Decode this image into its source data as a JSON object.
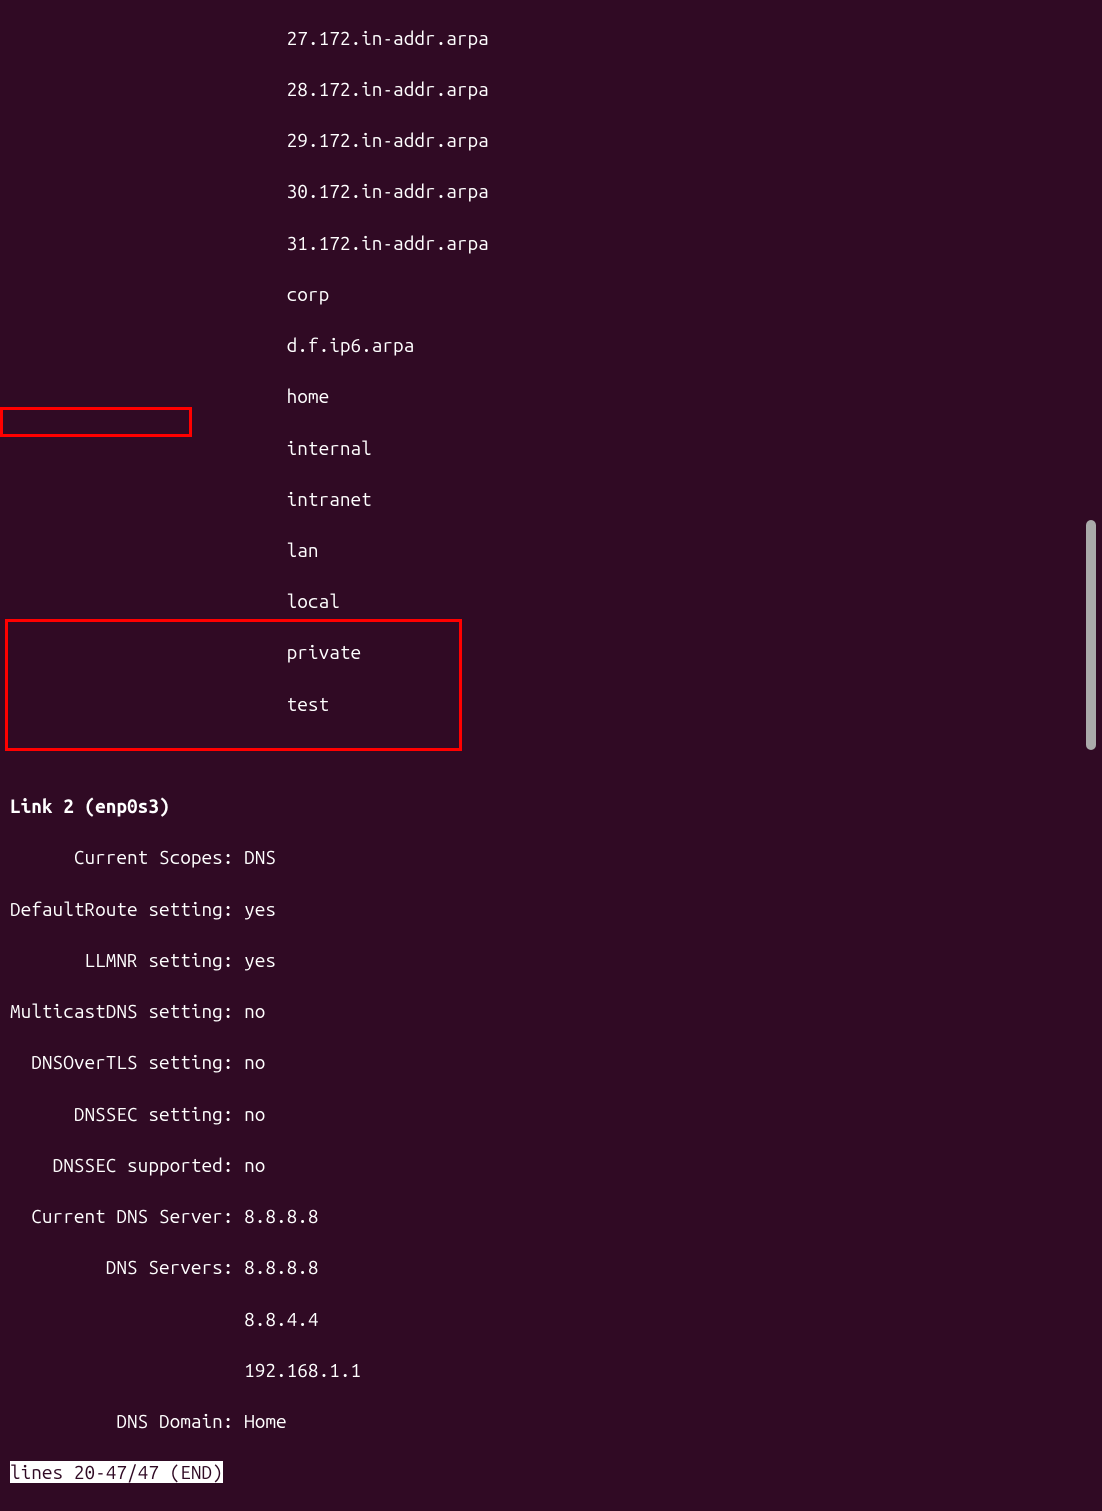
{
  "top_partial": "27.172.in-addr.arpa",
  "domain_list": [
    "28.172.in-addr.arpa",
    "29.172.in-addr.arpa",
    "30.172.in-addr.arpa",
    "31.172.in-addr.arpa",
    "corp",
    "d.f.ip6.arpa",
    "home",
    "internal",
    "intranet",
    "lan",
    "local",
    "private",
    "test"
  ],
  "link_header": "Link 2 (enp0s3)",
  "settings": [
    {
      "label": "Current Scopes:",
      "value": "DNS"
    },
    {
      "label": "DefaultRoute setting:",
      "value": "yes"
    },
    {
      "label": "LLMNR setting:",
      "value": "yes"
    },
    {
      "label": "MulticastDNS setting:",
      "value": "no"
    },
    {
      "label": "DNSOverTLS setting:",
      "value": "no"
    },
    {
      "label": "DNSSEC setting:",
      "value": "no"
    },
    {
      "label": "DNSSEC supported:",
      "value": "no"
    },
    {
      "label": "Current DNS Server:",
      "value": "8.8.8.8"
    },
    {
      "label": "DNS Servers:",
      "value": "8.8.8.8"
    },
    {
      "label": "",
      "value": "8.8.4.4"
    },
    {
      "label": "",
      "value": "192.168.1.1"
    },
    {
      "label": "DNS Domain:",
      "value": "Home"
    }
  ],
  "status_line": "lines 20-47/47 (END)"
}
